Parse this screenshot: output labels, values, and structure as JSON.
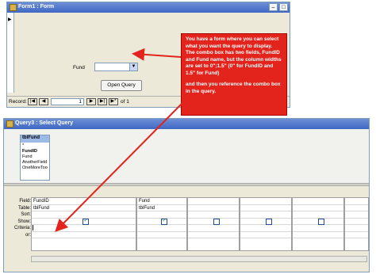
{
  "form_window": {
    "title": "Form1 : Form",
    "fund_label": "Fund",
    "fund_combo_value": "",
    "open_query_label": "Open Query",
    "navigation": {
      "record_label": "Record:",
      "current_record": "1",
      "of_label": "of 1",
      "first_icon": "first-record-icon",
      "prev_icon": "previous-record-icon",
      "next_icon": "next-record-icon",
      "last_icon": "last-record-icon",
      "new_icon": "new-record-icon"
    }
  },
  "callout": {
    "paragraph_1": "You have a form where you can select what you want the query to display. The combo box has two fields, FundID and Fund name, but the column widths are set to 0\";1.5\" (0\" for FundID and 1.5\" for Fund)",
    "paragraph_2": "and then you reference the combo box in the query.",
    "color": "#e3241d"
  },
  "query_window": {
    "title": "Query3 : Select Query",
    "table": {
      "name": "tblFund",
      "fields": [
        "*",
        "FundID",
        "Fund",
        "AnotherField",
        "OneMoreToo"
      ]
    },
    "grid": {
      "row_labels": [
        "Field:",
        "Table:",
        "Sort:",
        "Show:",
        "Criteria:",
        "or:"
      ],
      "columns": [
        {
          "field": "FundID",
          "table": "tblFund",
          "show": true
        },
        {
          "field": "Fund",
          "table": "tblFund",
          "show": true
        },
        {
          "field": "",
          "table": "",
          "show": false
        },
        {
          "field": "",
          "table": "",
          "show": false
        },
        {
          "field": "",
          "table": "",
          "show": false
        }
      ]
    }
  },
  "annotation_color": "#e3241d"
}
